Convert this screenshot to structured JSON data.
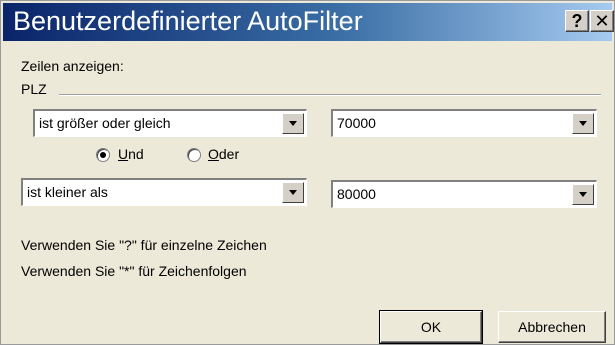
{
  "window": {
    "title": "Benutzerdefinierter AutoFilter",
    "help_label": "?",
    "close_label": "✕"
  },
  "dialog": {
    "show_rows_label": "Zeilen anzeigen:",
    "field_name": "PLZ",
    "criteria": [
      {
        "operator": "ist größer oder gleich",
        "value": "70000"
      },
      {
        "operator": "ist kleiner als",
        "value": "80000"
      }
    ],
    "logic": {
      "and_prefix": "",
      "and_key": "U",
      "and_rest": "nd",
      "or_key": "O",
      "or_rest": "der",
      "selected": "and"
    },
    "hints": [
      "Verwenden Sie \"?\" für einzelne Zeichen",
      "Verwenden Sie \"*\" für Zeichenfolgen"
    ],
    "buttons": {
      "ok": "OK",
      "cancel": "Abbrechen"
    }
  }
}
